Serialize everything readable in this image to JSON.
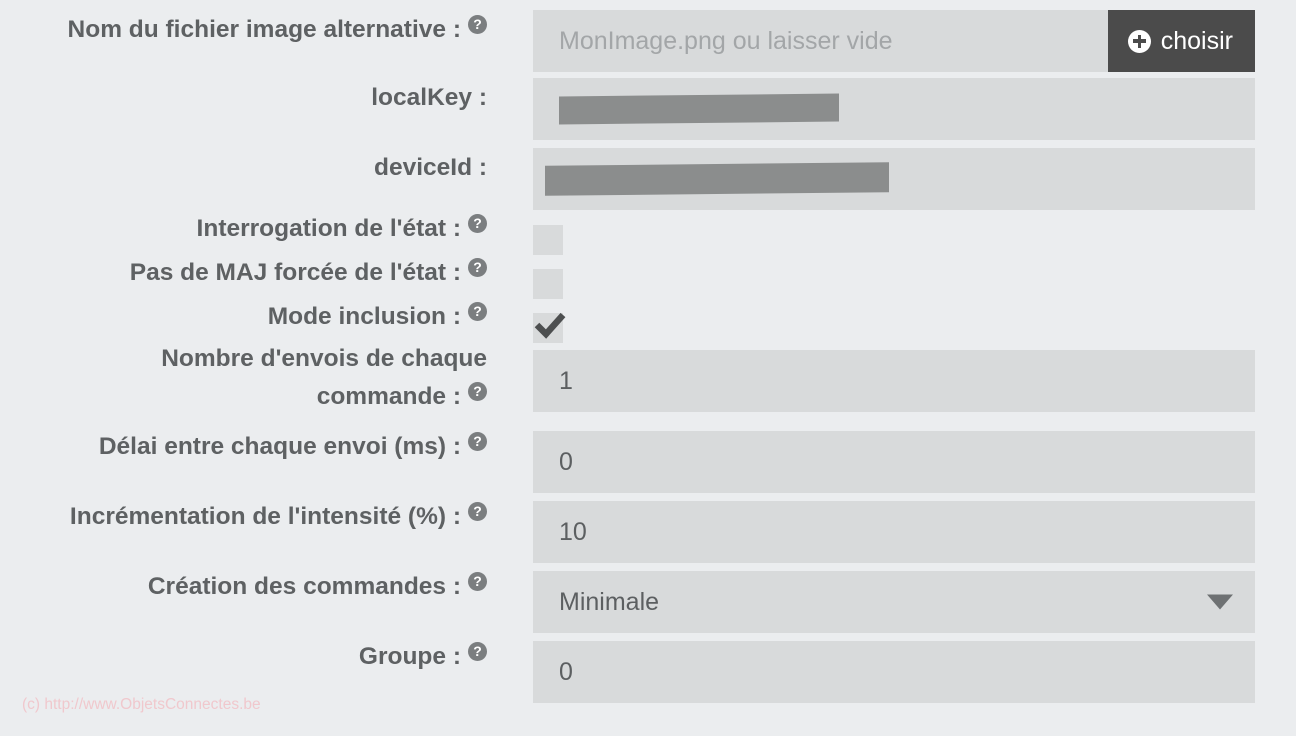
{
  "page": {
    "background_color": "#ebedef",
    "label_color": "#5e6163",
    "field_background": "#d8dadb",
    "button_color": "#4b4b4b",
    "watermark_color": "#f0c8cd"
  },
  "rows": [
    {
      "label": "Nom du fichier image alternative :",
      "has_help": true,
      "type": "text_with_button",
      "value": "",
      "placeholder": "MonImage.png ou laisser vide",
      "button_label": "choisir",
      "button_icon": "plus-circle-icon"
    },
    {
      "label": "localKey :",
      "has_help": false,
      "type": "text_redacted",
      "value": "",
      "placeholder": ""
    },
    {
      "label": "deviceId :",
      "has_help": false,
      "type": "text_redacted",
      "value": "",
      "placeholder": ""
    },
    {
      "label": "Interrogation de l'état :",
      "has_help": true,
      "type": "checkbox",
      "checked": false
    },
    {
      "label": "Pas de MAJ forcée de l'état :",
      "has_help": true,
      "type": "checkbox",
      "checked": false
    },
    {
      "label": "Mode inclusion :",
      "has_help": true,
      "type": "checkbox",
      "checked": true
    },
    {
      "label": "Nombre d'envois de chaque commande :",
      "has_help": true,
      "type": "text",
      "value": "1",
      "placeholder": ""
    },
    {
      "label": "Délai entre chaque envoi (ms) :",
      "has_help": true,
      "type": "text",
      "value": "0",
      "placeholder": ""
    },
    {
      "label": "Incrémentation de l'intensité (%) :",
      "has_help": true,
      "type": "text",
      "value": "10",
      "placeholder": ""
    },
    {
      "label": "Création des commandes :",
      "has_help": true,
      "type": "select",
      "value": "Minimale"
    },
    {
      "label": "Groupe :",
      "has_help": true,
      "type": "text",
      "value": "0",
      "placeholder": ""
    }
  ],
  "help_icon_glyph": "?",
  "watermark": "(c) http://www.ObjetsConnectes.be"
}
